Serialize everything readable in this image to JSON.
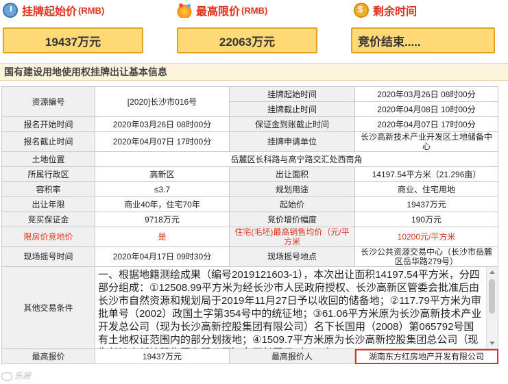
{
  "header": {
    "start_price_title": "挂牌起始价",
    "start_price_unit": "(RMB)",
    "max_price_title": "最高限价",
    "max_price_unit": "(RMB)",
    "remaining_title": "剩余时间",
    "start_price_value": "19437万元",
    "max_price_value": "22063万元",
    "remaining_value": "竞价结束....."
  },
  "section_title": "国有建设用地使用权挂牌出让基本信息",
  "table": {
    "resource_no_label": "资源编号",
    "resource_no": "[2020]长沙市016号",
    "listing_start_label": "挂牌起始时间",
    "listing_start": "2020年03月26日 08时00分",
    "listing_end_label": "挂牌截止时间",
    "listing_end": "2020年04月08日 10时00分",
    "apply_start_label": "报名开始时间",
    "apply_start": "2020年03月26日 08时00分",
    "deposit_deadline_label": "保证金到账截止时间",
    "deposit_deadline": "2020年04月07日 17时00分",
    "apply_end_label": "报名截止时间",
    "apply_end": "2020年04月07日 17时00分",
    "applicant_unit_label": "挂牌申请单位",
    "applicant_unit": "长沙高新技术产业开发区土地储备中心",
    "location_label": "土地位置",
    "location": "岳麓区长科路与高宁路交汇处西南角",
    "district_label": "所属行政区",
    "district": "高新区",
    "area_label": "出让面积",
    "area": "14197.54平方米（21.296亩）",
    "far_label": "容积率",
    "far": "≤3.7",
    "use_label": "规划用途",
    "use": "商业、住宅用地",
    "term_label": "出让年限",
    "term": "商业40年，住宅70年",
    "start_price_label": "起始价",
    "start_price": "19437万元",
    "bid_deposit_label": "竞买保证金",
    "bid_deposit": "9718万元",
    "increment_label": "竞价增价幅度",
    "increment": "190万元",
    "limit_label": "限房价竞地价",
    "limit": "是",
    "max_sale_price_label": "住宅(毛坯)最高销售均价（元/平方米",
    "max_sale_price": "10200元/平方米",
    "lottery_time_label": "现场摇号时间",
    "lottery_time": "2020年04月17日 09时30分",
    "lottery_place_label": "现场摇号地点",
    "lottery_place": "长沙公共资源交易中心（长沙市岳麓区岳华路279号）",
    "other_label": "其他交易条件",
    "other_conditions": "一、根据地籍测绘成果（编号2019121603-1），本次出让面积14197.54平方米，分四部分组成：①12508.99平方米为经长沙市人民政府授权、长沙高新区管委会批准后由长沙市自然资源和规划局于2019年11月27日予以收回的储备地；②117.79平方米为审批单号（2002）政国土字第354号中的统征地；③61.06平方米原为长沙高新技术产业开发总公司（现为长沙高新控股集团有限公司）名下长国用（2008）第065792号国有土地权证范围内的部分划拨地；④1509.7平方米原为长沙高新控股集团总公司（现为长沙高新控股集团有限公司）名下长国用（2015）",
    "max_bid_label": "最高报价",
    "max_bid": "19437万元",
    "max_bidder_label": "最高报价人",
    "max_bidder": "湖南东方红房地产开发有限公司"
  },
  "watermark": "乐居"
}
